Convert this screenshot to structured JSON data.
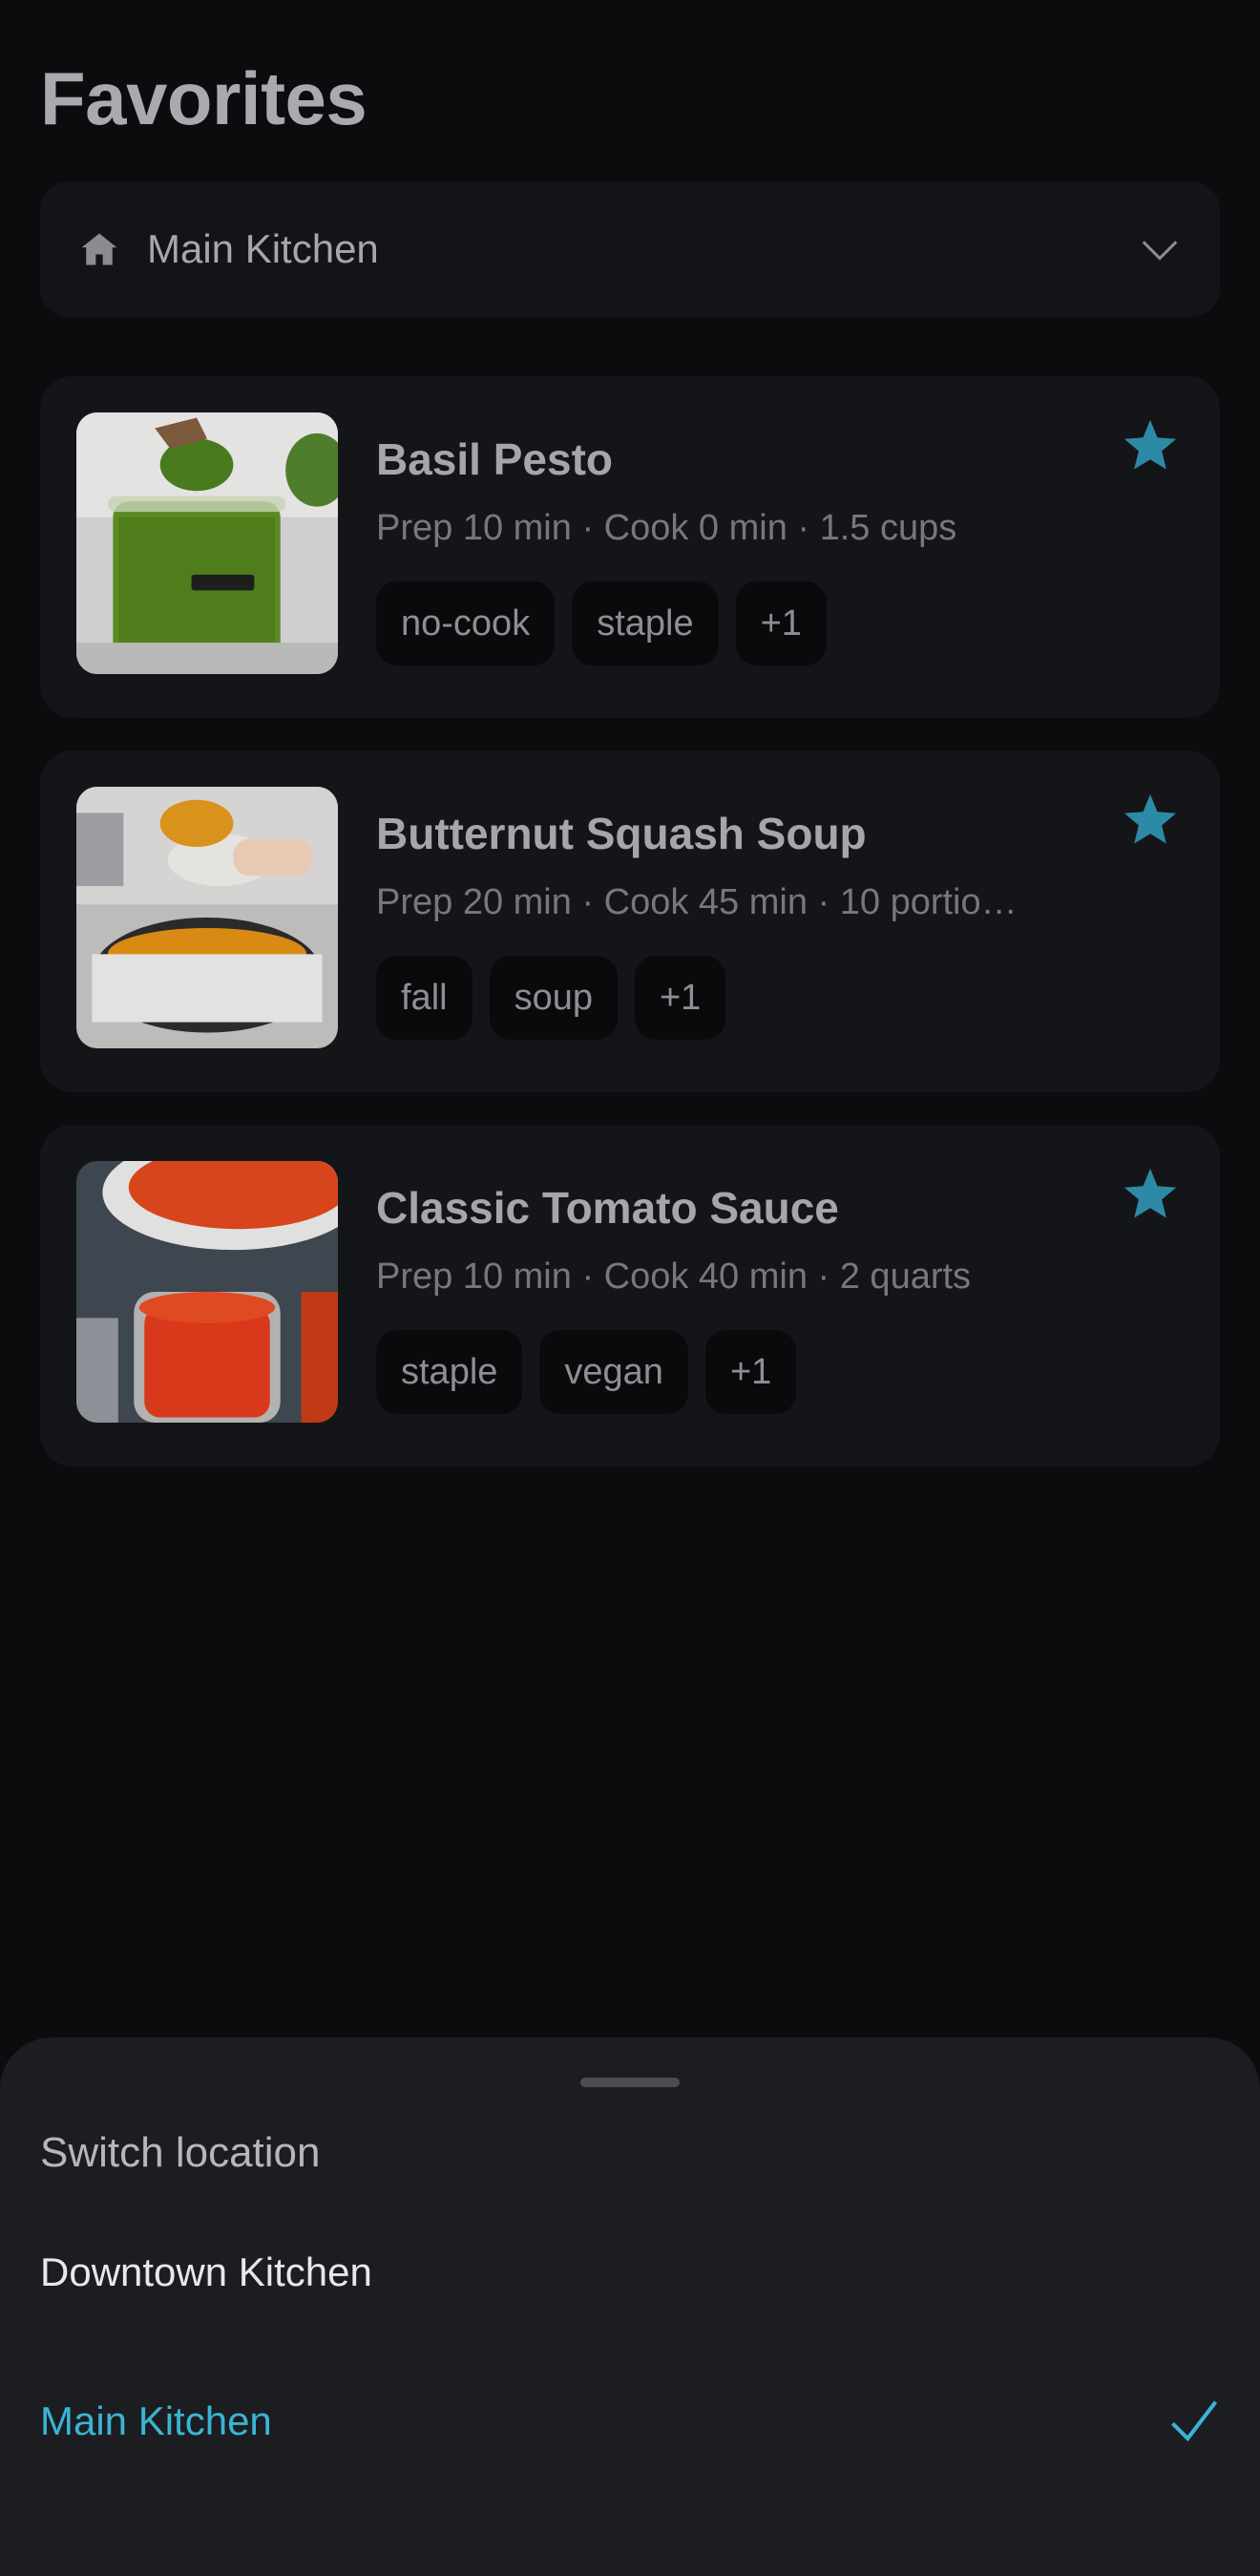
{
  "page": {
    "title": "Favorites"
  },
  "location_select": {
    "current": "Main Kitchen",
    "icon": "home-icon",
    "chevron": "chevron-down-icon"
  },
  "recipes": [
    {
      "title": "Basil Pesto",
      "meta": "Prep 10 min · Cook 0 min · 1.5 cups",
      "tags": [
        "no-cook",
        "staple",
        "+1"
      ],
      "favorited": true,
      "image": "pesto-jar-photo"
    },
    {
      "title": "Butternut Squash Soup",
      "meta": "Prep 20 min · Cook 45 min · 10 portio…",
      "tags": [
        "fall",
        "soup",
        "+1"
      ],
      "favorited": true,
      "image": "squash-soup-photo"
    },
    {
      "title": "Classic Tomato Sauce",
      "meta": "Prep 10 min · Cook 40 min · 2 quarts",
      "tags": [
        "staple",
        "vegan",
        "+1"
      ],
      "favorited": true,
      "image": "tomato-sauce-photo"
    }
  ],
  "sheet": {
    "title": "Switch location",
    "options": [
      {
        "label": "Downtown Kitchen",
        "selected": false
      },
      {
        "label": "Main Kitchen",
        "selected": true
      }
    ]
  },
  "colors": {
    "accent": "#3ab4d6",
    "star": "#2d8aa6",
    "background": "#0b0c0e",
    "card": "#141518",
    "sheet": "#1c1d20"
  }
}
